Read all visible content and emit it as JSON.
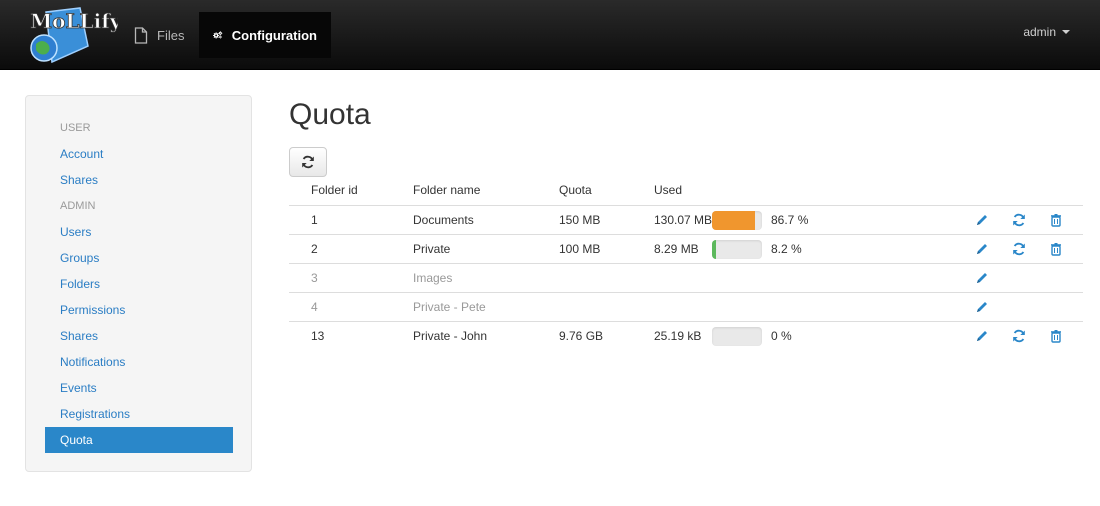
{
  "app": {
    "logo_text": "MoLLify"
  },
  "navbar": {
    "files_label": "Files",
    "config_label": "Configuration",
    "user_label": "admin"
  },
  "sidebar": {
    "sections": [
      {
        "header": "USER",
        "items": [
          "Account",
          "Shares"
        ]
      },
      {
        "header": "ADMIN",
        "items": [
          "Users",
          "Groups",
          "Folders",
          "Permissions",
          "Shares",
          "Notifications",
          "Events",
          "Registrations",
          "Quota"
        ]
      }
    ],
    "active": "Quota"
  },
  "page": {
    "title": "Quota"
  },
  "table": {
    "columns": [
      "Folder id",
      "Folder name",
      "Quota",
      "Used"
    ],
    "rows": [
      {
        "id": "1",
        "name": "Documents",
        "quota": "150 MB",
        "used": "130.07 MB",
        "percent_label": "86.7 %",
        "fill": 0.867,
        "bar_color": "#f0962e",
        "muted": false,
        "actions": [
          "edit",
          "refresh",
          "delete"
        ]
      },
      {
        "id": "2",
        "name": "Private",
        "quota": "100 MB",
        "used": "8.29 MB",
        "percent_label": "8.2 %",
        "fill": 0.082,
        "bar_color": "#5cb85c",
        "muted": false,
        "actions": [
          "edit",
          "refresh",
          "delete"
        ]
      },
      {
        "id": "3",
        "name": "Images",
        "quota": "",
        "used": "",
        "percent_label": "",
        "fill": null,
        "bar_color": "",
        "muted": true,
        "actions": [
          "edit"
        ]
      },
      {
        "id": "4",
        "name": "Private - Pete",
        "quota": "",
        "used": "",
        "percent_label": "",
        "fill": null,
        "bar_color": "",
        "muted": true,
        "actions": [
          "edit"
        ]
      },
      {
        "id": "13",
        "name": "Private - John",
        "quota": "9.76 GB",
        "used": "25.19 kB",
        "percent_label": "0 %",
        "fill": 0.0,
        "bar_color": "#5cb85c",
        "muted": false,
        "actions": [
          "edit",
          "refresh",
          "delete"
        ]
      }
    ]
  },
  "colors": {
    "link": "#2a7dc4",
    "active_bg": "#2a87c9",
    "icon": "#2a87c9"
  },
  "icons": {
    "files": "file-icon",
    "config": "gears-icon",
    "refresh": "refresh-icon",
    "edit": "pencil-icon",
    "delete": "trash-icon"
  }
}
